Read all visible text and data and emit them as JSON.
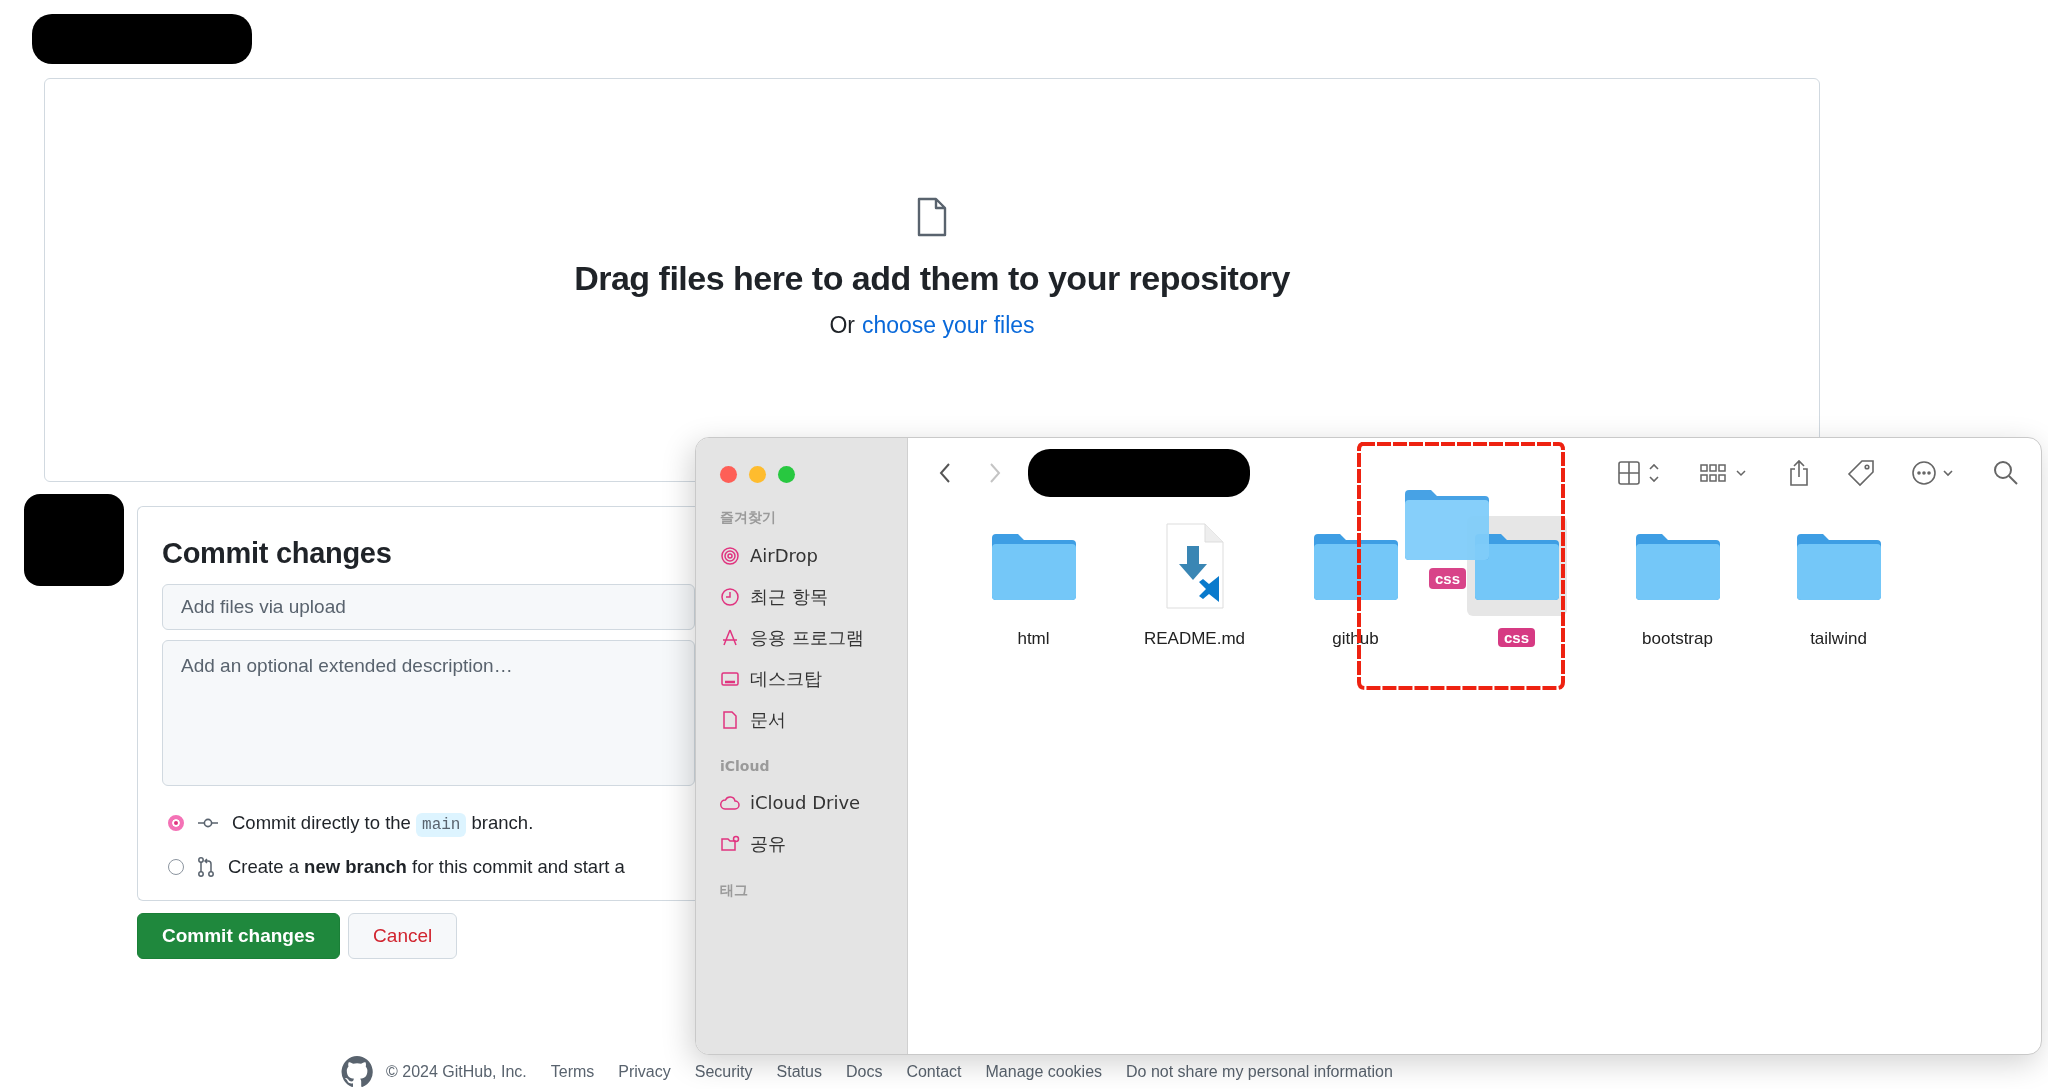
{
  "upload": {
    "heading": "Drag files here to add them to your repository",
    "prompt": "Or",
    "link": "choose your files"
  },
  "commit": {
    "title": "Commit changes",
    "summary_placeholder": "Add files via upload",
    "description_placeholder": "Add an optional extended description…",
    "options": [
      {
        "kind": "code",
        "before": "Commit directly to the",
        "code": "main",
        "after": "branch.",
        "selected": true
      },
      {
        "kind": "plain",
        "text": "Create a **new branch** for this commit and start a",
        "selected": false
      }
    ],
    "buttons": [
      {
        "label": "Commit changes",
        "kind": "primary"
      },
      {
        "label": "Cancel",
        "kind": "danger"
      }
    ]
  },
  "footer": {
    "copyright": "© 2024 GitHub, Inc.",
    "links": [
      "Terms",
      "Privacy",
      "Security",
      "Status",
      "Docs",
      "Contact",
      "Manage cookies",
      "Do not share my personal information"
    ]
  },
  "finder": {
    "forward_enabled": false,
    "sidebar": [
      {
        "header": "즐겨찾기",
        "items": [
          "AirDrop",
          "최근 항목",
          "응용 프로그램",
          "데스크탑",
          "문서"
        ]
      },
      {
        "header": "iCloud",
        "items": [
          "iCloud Drive",
          "공유"
        ]
      },
      {
        "header": "태그"
      }
    ],
    "files": [
      {
        "name": "html",
        "kind": "folder",
        "selected": false
      },
      {
        "name": "README.md",
        "kind": "document",
        "selected": false
      },
      {
        "name": "github",
        "kind": "folder",
        "selected": false
      },
      {
        "name": "css",
        "kind": "folder",
        "selected": true
      },
      {
        "name": "bootstrap",
        "kind": "folder",
        "selected": false
      },
      {
        "name": "tailwind",
        "kind": "folder",
        "selected": false
      }
    ],
    "drag_ghost": {
      "label": "css"
    }
  }
}
